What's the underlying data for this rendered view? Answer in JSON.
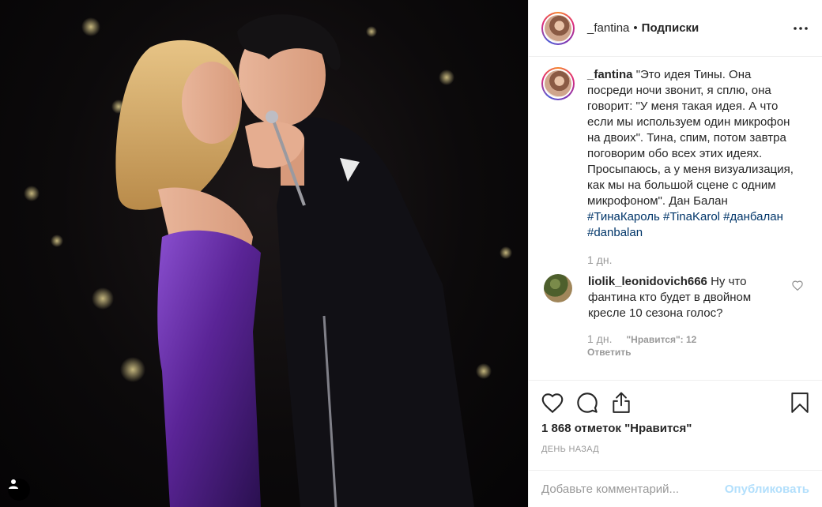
{
  "post": {
    "username": "_fantina",
    "follow_label": "Подписки",
    "separator": "•"
  },
  "caption": {
    "username": "_fantina",
    "text": "\"Это идея Тины. Она посреди ночи звонит, я сплю, она говорит: \"У меня такая идея. А что если мы используем один микрофон на двоих\". Тина, спим, потом завтра поговорим обо всех этих идеях. Просыпаюсь, а у меня визуализация, как мы на большой сцене с одним микрофоном\". Дан Балан",
    "hashtags": "#ТинаКароль #TinaKarol #данбалан #danbalan",
    "time": "1 дн."
  },
  "comments": [
    {
      "username": "liolik_leonidovich666",
      "text": "Ну что фантина кто будет в двойном кресле 10 сезона голос?",
      "time": "1 дн.",
      "likes": "\"Нравится\": 12",
      "reply": "Ответить"
    }
  ],
  "actions": {
    "likes_count": "1 868 отметок \"Нравится\"",
    "date": "день назад"
  },
  "add_comment": {
    "placeholder": "Добавьте комментарий...",
    "publish_label": "Опубликовать"
  },
  "icons": {
    "more": "more-horizontal-icon",
    "like": "heart-icon",
    "comment": "comment-bubble-icon",
    "share": "share-icon",
    "save": "bookmark-icon",
    "tags": "user-tag-icon"
  },
  "colors": {
    "hashtag": "#003569",
    "publish_disabled": "#b2dffc",
    "muted": "#999999",
    "dress": "#6a2fa8"
  }
}
